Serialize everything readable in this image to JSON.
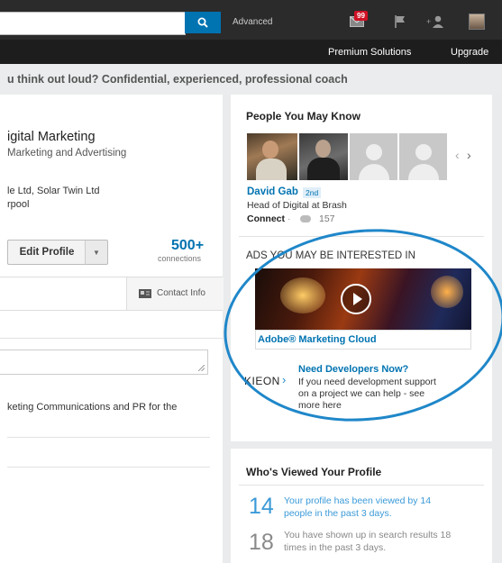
{
  "topbar": {
    "advanced_label": "Advanced",
    "inbox_count": "99",
    "accent": "#0073b1"
  },
  "nav": {
    "premium_label": "Premium Solutions",
    "upgrade_label": "Upgrade"
  },
  "profile": {
    "headline": "u think out loud? Confidential, experienced, professional coach",
    "title": "igital Marketing",
    "industry": "Marketing and Advertising",
    "companies": "le Ltd, Solar Twin Ltd",
    "location": "rpool",
    "edit_label": "Edit Profile",
    "connections_count": "500+",
    "connections_label": "connections",
    "contact_label": "Contact Info",
    "summary": "keting Communications and PR for the"
  },
  "pymk": {
    "heading": "People You May Know",
    "name": "David Gab",
    "degree": "2nd",
    "role": "Head of Digital at Brash",
    "connect_label": "Connect",
    "separator": "·",
    "shared_count": "157"
  },
  "ads": {
    "heading": "ADS YOU MAY BE INTERESTED IN",
    "ad1_title": "Adobe® Marketing Cloud",
    "ad2_logo": "KIEON",
    "ad2_title": "Need Developers Now?",
    "ad2_line1": "If you need development support",
    "ad2_line2": "on a project we can help - see",
    "ad2_line3": "more here"
  },
  "viewed": {
    "heading": "Who's Viewed Your Profile",
    "stat1_num": "14",
    "stat1_line1": "Your profile has been viewed by 14",
    "stat1_line2": "people in the past 3 days.",
    "stat2_num": "18",
    "stat2_line1": "You have shown up in search results 18",
    "stat2_line2": "times in the past 3 days."
  }
}
